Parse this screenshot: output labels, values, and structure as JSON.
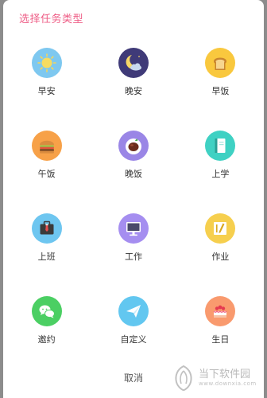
{
  "dialog": {
    "title": "选择任务类型",
    "cancel_label": "取消"
  },
  "task_types": [
    {
      "label": "早安",
      "icon": "sun-icon",
      "color": "#7ec8f0"
    },
    {
      "label": "晚安",
      "icon": "moon-cloud-icon",
      "color": "#3f3a78"
    },
    {
      "label": "早饭",
      "icon": "bread-icon",
      "color": "#f9c83e"
    },
    {
      "label": "午饭",
      "icon": "burger-icon",
      "color": "#f7a148"
    },
    {
      "label": "晚饭",
      "icon": "dinner-plate-icon",
      "color": "#9a86e6"
    },
    {
      "label": "上学",
      "icon": "book-icon",
      "color": "#3fd1c3"
    },
    {
      "label": "上班",
      "icon": "briefcase-icon",
      "color": "#6ec6f0"
    },
    {
      "label": "工作",
      "icon": "monitor-icon",
      "color": "#a58ef0"
    },
    {
      "label": "作业",
      "icon": "pencil-paper-icon",
      "color": "#f6cf4e"
    },
    {
      "label": "邀约",
      "icon": "chat-icon",
      "color": "#4bcf63"
    },
    {
      "label": "自定义",
      "icon": "paper-plane-icon",
      "color": "#62c7f0"
    },
    {
      "label": "生日",
      "icon": "cake-icon",
      "color": "#f99a6e"
    }
  ],
  "watermark": {
    "main_text": "当下软件园",
    "sub_text": "www.downxia.com"
  }
}
